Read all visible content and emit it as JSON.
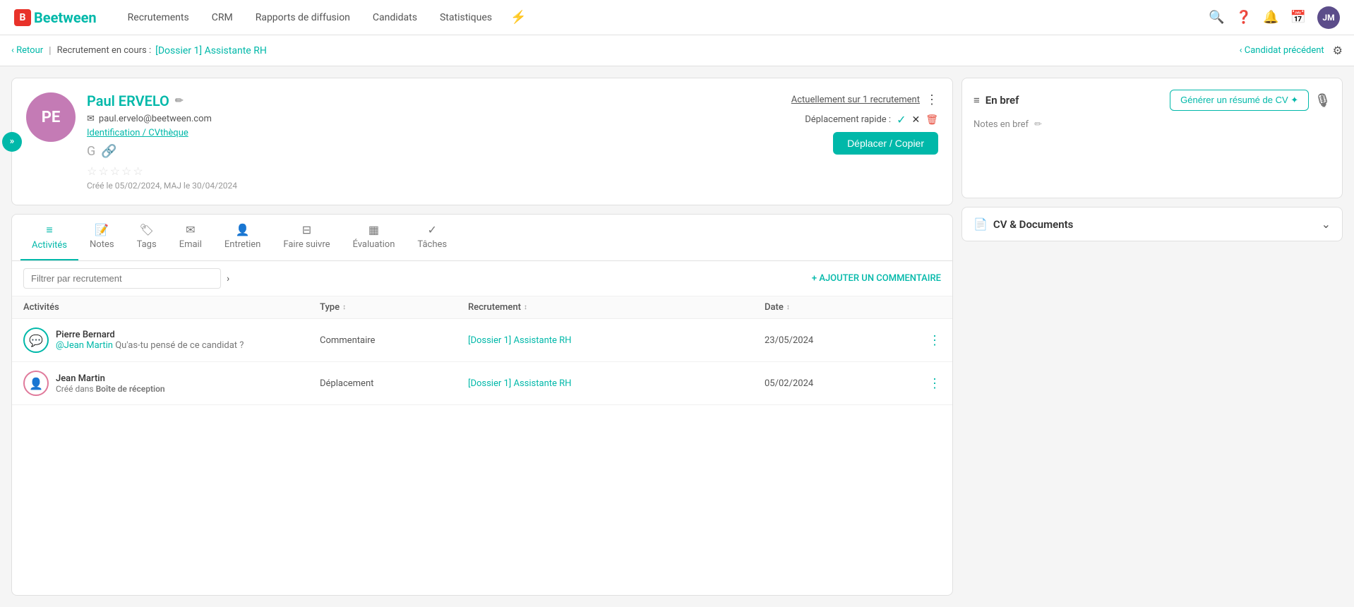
{
  "nav": {
    "logo": "Beetween",
    "links": [
      "Recrutements",
      "CRM",
      "Rapports de diffusion",
      "Candidats",
      "Statistiques"
    ],
    "bolt_icon": "⚡",
    "avatar_initials": "JM"
  },
  "breadcrumb": {
    "back_label": "‹ Retour",
    "in_progress_label": "Recrutement en cours :",
    "dossier_link": "[Dossier 1] Assistante RH",
    "prev_candidate": "‹ Candidat précédent"
  },
  "candidate": {
    "initials": "PE",
    "name": "Paul ERVELO",
    "email": "paul.ervelo@beetween.com",
    "id_link": "Identification / CVthèque",
    "recruitment_link": "Actuellement sur 1 recrutement",
    "created_date": "Créé le 05/02/2024, MAJ le 30/04/2024",
    "stars": [
      "☆",
      "☆",
      "☆",
      "☆",
      "☆"
    ],
    "quick_move_label": "Déplacement rapide :",
    "move_copy_btn": "Déplacer / Copier"
  },
  "tabs": [
    {
      "id": "activites",
      "icon": "≡",
      "label": "Activités",
      "active": true
    },
    {
      "id": "notes",
      "icon": "📝",
      "label": "Notes",
      "active": false
    },
    {
      "id": "tags",
      "icon": "🏷",
      "label": "Tags",
      "active": false
    },
    {
      "id": "email",
      "icon": "✉",
      "label": "Email",
      "active": false
    },
    {
      "id": "entretien",
      "icon": "👤",
      "label": "Entretien",
      "active": false
    },
    {
      "id": "faire-suivre",
      "icon": "⊟",
      "label": "Faire suivre",
      "active": false
    },
    {
      "id": "evaluation",
      "icon": "▦",
      "label": "Évaluation",
      "active": false
    },
    {
      "id": "taches",
      "icon": "✓",
      "label": "Tâches",
      "active": false
    }
  ],
  "filter": {
    "placeholder": "Filtrer par recrutement",
    "add_comment": "+ AJOUTER UN COMMENTAIRE"
  },
  "table": {
    "headers": [
      {
        "label": "Activités"
      },
      {
        "label": "Type"
      },
      {
        "label": "Recrutement"
      },
      {
        "label": "Date"
      }
    ],
    "rows": [
      {
        "id": "row1",
        "avatar_icon": "💬",
        "avatar_color": "teal",
        "user_name": "Pierre Bernard",
        "mention": "@Jean Martin",
        "subtext": "Qu'as-tu pensé de ce candidat ?",
        "type": "Commentaire",
        "recruitment": "[Dossier 1] Assistante RH",
        "date": "23/05/2024"
      },
      {
        "id": "row2",
        "avatar_icon": "👤",
        "avatar_color": "pink",
        "user_name": "Jean Martin",
        "mention": "",
        "subtext_pre": "Créé dans ",
        "subtext_bold": "Boîte de réception",
        "type": "Déplacement",
        "recruitment": "[Dossier 1] Assistante RH",
        "date": "05/02/2024"
      }
    ]
  },
  "right_panel": {
    "en_bref": {
      "title": "En bref",
      "notes_label": "Notes en bref",
      "generate_cv_btn": "Générer un résumé de CV ✦"
    },
    "cv_documents": {
      "title": "CV & Documents"
    }
  }
}
